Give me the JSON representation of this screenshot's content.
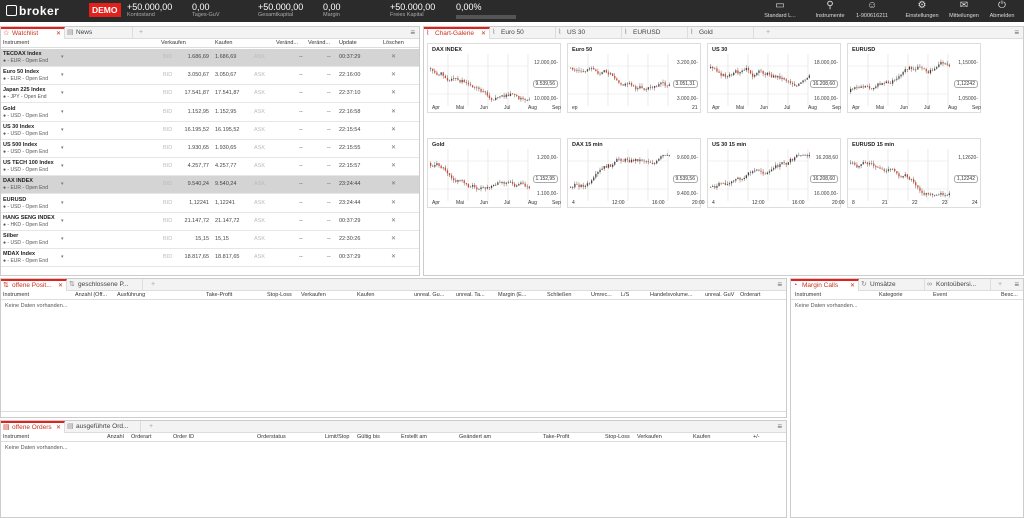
{
  "topbar": {
    "brand": "broker",
    "demo": "DEMO",
    "metrics": [
      {
        "value": "+50.000,00",
        "label": "Kontostand"
      },
      {
        "value": "0,00",
        "label": "Tages-GuV"
      },
      {
        "value": "+50.000,00",
        "label": "Gesamtkapital"
      },
      {
        "value": "0,00",
        "label": "Margin"
      },
      {
        "value": "+50.000,00",
        "label": "Freies Kapital"
      },
      {
        "value": "0,00%",
        "label": ""
      }
    ],
    "nav": [
      {
        "label": "Standard L...",
        "icon": "window-icon"
      },
      {
        "label": "Instrumente",
        "icon": "search-icon"
      },
      {
        "label": "1-900616211",
        "icon": "user-icon"
      },
      {
        "label": "Einstellungen",
        "icon": "gear-icon"
      },
      {
        "label": "Mitteilungen",
        "icon": "mail-icon"
      },
      {
        "label": "Abmelden",
        "icon": "power-icon"
      }
    ]
  },
  "watchlist": {
    "tabs": [
      {
        "label": "Watchlist"
      },
      {
        "label": "News"
      }
    ],
    "columns": [
      "Instrument",
      "Verkaufen",
      "Kaufen",
      "Veränd...",
      "Veränd...",
      "Update",
      "Löschen"
    ],
    "bid_label": "BID",
    "ask_label": "ASK",
    "rows": [
      {
        "name": "TECDAX Index",
        "sub": "- EUR - Open End",
        "sell": "1.686,69",
        "buy": "1.686,69",
        "d1": "--",
        "d2": "--",
        "update": "00:37:29",
        "hl": true
      },
      {
        "name": "Euro 50 Index",
        "sub": "- EUR - Open End",
        "sell": "3.050,67",
        "buy": "3.050,67",
        "d1": "--",
        "d2": "--",
        "update": "22:16:00",
        "hl": false
      },
      {
        "name": "Japan 225 Index",
        "sub": "- JPY - Open End",
        "sell": "17.541,87",
        "buy": "17.541,87",
        "d1": "--",
        "d2": "--",
        "update": "22:37:10",
        "hl": false
      },
      {
        "name": "Gold",
        "sub": "- USD - Open End",
        "sell": "1.152,95",
        "buy": "1.152,95",
        "d1": "--",
        "d2": "--",
        "update": "22:16:58",
        "hl": false
      },
      {
        "name": "US 30 Index",
        "sub": "- USD - Open End",
        "sell": "16.195,52",
        "buy": "16.195,52",
        "d1": "--",
        "d2": "--",
        "update": "22:15:54",
        "hl": false
      },
      {
        "name": "US 500 Index",
        "sub": "- USD - Open End",
        "sell": "1.930,65",
        "buy": "1.930,65",
        "d1": "--",
        "d2": "--",
        "update": "22:15:55",
        "hl": false
      },
      {
        "name": "US TECH 100 Index",
        "sub": "- USD - Open End",
        "sell": "4.257,77",
        "buy": "4.257,77",
        "d1": "--",
        "d2": "--",
        "update": "22:15:57",
        "hl": false
      },
      {
        "name": "DAX INDEX",
        "sub": "- EUR - Open End",
        "sell": "9.540,24",
        "buy": "9.540,24",
        "d1": "--",
        "d2": "--",
        "update": "23:24:44",
        "hl": true
      },
      {
        "name": "EURUSD",
        "sub": "- USD - Open End",
        "sell": "1,12241",
        "buy": "1,12241",
        "d1": "--",
        "d2": "--",
        "update": "23:24:44",
        "hl": false
      },
      {
        "name": "HANG SENG INDEX",
        "sub": "- HKD - Open End",
        "sell": "21.147,72",
        "buy": "21.147,72",
        "d1": "--",
        "d2": "--",
        "update": "00:37:29",
        "hl": false
      },
      {
        "name": "Silber",
        "sub": "- USD - Open End",
        "sell": "15,15",
        "buy": "15,15",
        "d1": "--",
        "d2": "--",
        "update": "22:30:26",
        "hl": false
      },
      {
        "name": "MDAX Index",
        "sub": "- EUR - Open End",
        "sell": "18.817,65",
        "buy": "18.817,65",
        "d1": "--",
        "d2": "--",
        "update": "00:37:29",
        "hl": false
      }
    ]
  },
  "charts_panel": {
    "tabs": [
      {
        "label": "Chart-Galerie"
      },
      {
        "label": "Euro 50"
      },
      {
        "label": "US 30"
      },
      {
        "label": "EURUSD"
      },
      {
        "label": "Gold"
      }
    ],
    "charts": [
      {
        "title": "DAX INDEX",
        "xlabels": [
          "Apr",
          "Mai",
          "Jun",
          "Jul",
          "Aug",
          "Sep"
        ],
        "levels": [
          "12.000,00-",
          "10.000,00-"
        ],
        "current": "9.539,56",
        "seed": 1,
        "trend": -1
      },
      {
        "title": "Euro 50",
        "xlabels": [
          "ep",
          "21"
        ],
        "levels": [
          "3.200,00-",
          "3.000,00-"
        ],
        "current": "3.051,31",
        "seed": 2,
        "trend": -1
      },
      {
        "title": "US 30",
        "xlabels": [
          "Apr",
          "Mai",
          "Jun",
          "Jul",
          "Aug",
          "Sep"
        ],
        "levels": [
          "18.000,00-",
          "16.000,00-"
        ],
        "current": "16.208,60",
        "seed": 3,
        "trend": -1
      },
      {
        "title": "EURUSD",
        "xlabels": [
          "Apr",
          "Mai",
          "Jun",
          "Jul",
          "Aug",
          "Sep"
        ],
        "levels": [
          "1,15000-",
          "1,05000-"
        ],
        "current": "1,12242",
        "seed": 4,
        "trend": 1
      },
      {
        "title": "Gold",
        "xlabels": [
          "Apr",
          "Mai",
          "Jun",
          "Jul",
          "Aug",
          "Sep"
        ],
        "levels": [
          "1.200,00-",
          "1.100,00-"
        ],
        "current": "1.152,95",
        "seed": 5,
        "trend": -1
      },
      {
        "title": "DAX 15 min",
        "xlabels": [
          "4",
          "12:00",
          "16:00",
          "20:00"
        ],
        "levels": [
          "9.600,00-",
          "9.400,00-"
        ],
        "current": "9.539,56",
        "seed": 6,
        "trend": 1
      },
      {
        "title": "US 30 15 min",
        "xlabels": [
          "4",
          "12:00",
          "16:00",
          "20:00"
        ],
        "levels": [
          "16.208,60",
          "16.000,00-"
        ],
        "current": "16.208,60",
        "seed": 7,
        "trend": 1
      },
      {
        "title": "EURUSD 15 min",
        "xlabels": [
          "8",
          "21",
          "22",
          "23",
          "24"
        ],
        "levels": [
          "1,12620-",
          ""
        ],
        "current": "1,12242",
        "seed": 8,
        "trend": -1
      }
    ]
  },
  "positions": {
    "tabs": [
      {
        "label": "offene Posit..."
      },
      {
        "label": "geschlossene P..."
      }
    ],
    "columns": [
      "Instrument",
      "Anzahl (Off...",
      "Ausführung",
      "Take-Profit",
      "Stop-Loss",
      "Verkaufen",
      "Kaufen",
      "unreal. Gu...",
      "unreal. Ta...",
      "Margin (E...",
      "Schließen",
      "Umrec...",
      "L/S",
      "Handelsvolume...",
      "unreal. GuV",
      "Orderart"
    ],
    "empty": "Keine Daten vorhanden..."
  },
  "margin": {
    "tabs": [
      {
        "label": "Margin Calls"
      },
      {
        "label": "Umsätze"
      },
      {
        "label": "Kontoübersi..."
      }
    ],
    "columns": [
      "Instrument",
      "Kategorie",
      "Event",
      "Besc..."
    ],
    "empty": "Keine Daten vorhanden..."
  },
  "orders": {
    "tabs": [
      {
        "label": "offene Orders"
      },
      {
        "label": "ausgeführte Ord..."
      }
    ],
    "columns": [
      "Instrument",
      "Anzahl",
      "Orderart",
      "Order ID",
      "Orderstatus",
      "Limit/Stop",
      "Gültig bis",
      "Erstellt am",
      "Geändert am",
      "Take-Profit",
      "Stop-Loss",
      "Verkaufen",
      "Kaufen",
      "+/-"
    ],
    "empty": "Keine Daten vorhanden..."
  }
}
